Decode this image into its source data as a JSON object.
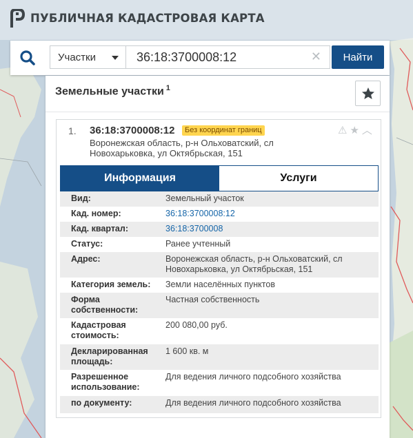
{
  "app": {
    "title": "ПУБЛИЧНАЯ КАДАСТРОВАЯ КАРТА"
  },
  "search": {
    "type_selected": "Участки",
    "query": "36:18:3700008:12",
    "clear_symbol": "✕",
    "find_label": "Найти"
  },
  "results": {
    "title": "Земельные участки",
    "count": "1"
  },
  "card": {
    "index": "1.",
    "cadastral_number": "36:18:3700008:12",
    "badge": "Без координат границ",
    "address_line1": "Воронежская область, р-н Ольховатский, сл",
    "address_line2": "Новохарьковка, ул Октябрьская, 151",
    "icons": [
      "warning-icon",
      "star-icon",
      "chevron-up-icon"
    ]
  },
  "tabs": {
    "info": "Информация",
    "services": "Услуги"
  },
  "info": [
    {
      "label": "Вид:",
      "value": "Земельный участок"
    },
    {
      "label": "Кад. номер:",
      "value": "36:18:3700008:12"
    },
    {
      "label": "Кад. квартал:",
      "value": "36:18:3700008"
    },
    {
      "label": "Статус:",
      "value": "Ранее учтенный"
    },
    {
      "label": "Адрес:",
      "value": "Воронежская область, р-н Ольховатский, сл Новохарьковка, ул Октябрьская, 151"
    },
    {
      "label": "Категория земель:",
      "value": "Земли населённых пунктов"
    },
    {
      "label": "Форма собственности:",
      "value": "Частная собственность"
    },
    {
      "label": "Кадастровая стоимость:",
      "value": "200 080,00 руб."
    },
    {
      "label": "Декларированная площадь:",
      "value": "1 600 кв. м"
    },
    {
      "label": "Разрешенное использование:",
      "value": "Для ведения личного подсобного хозяйства"
    },
    {
      "label": "по документу:",
      "value": "Для ведения личного подсобного хозяйства"
    }
  ],
  "colors": {
    "primary": "#154e87",
    "link": "#1565a8",
    "badge": "#ffd54f",
    "map_water": "#c4d3df",
    "map_land": "#e8ece4",
    "border_red": "#e05a5a"
  }
}
